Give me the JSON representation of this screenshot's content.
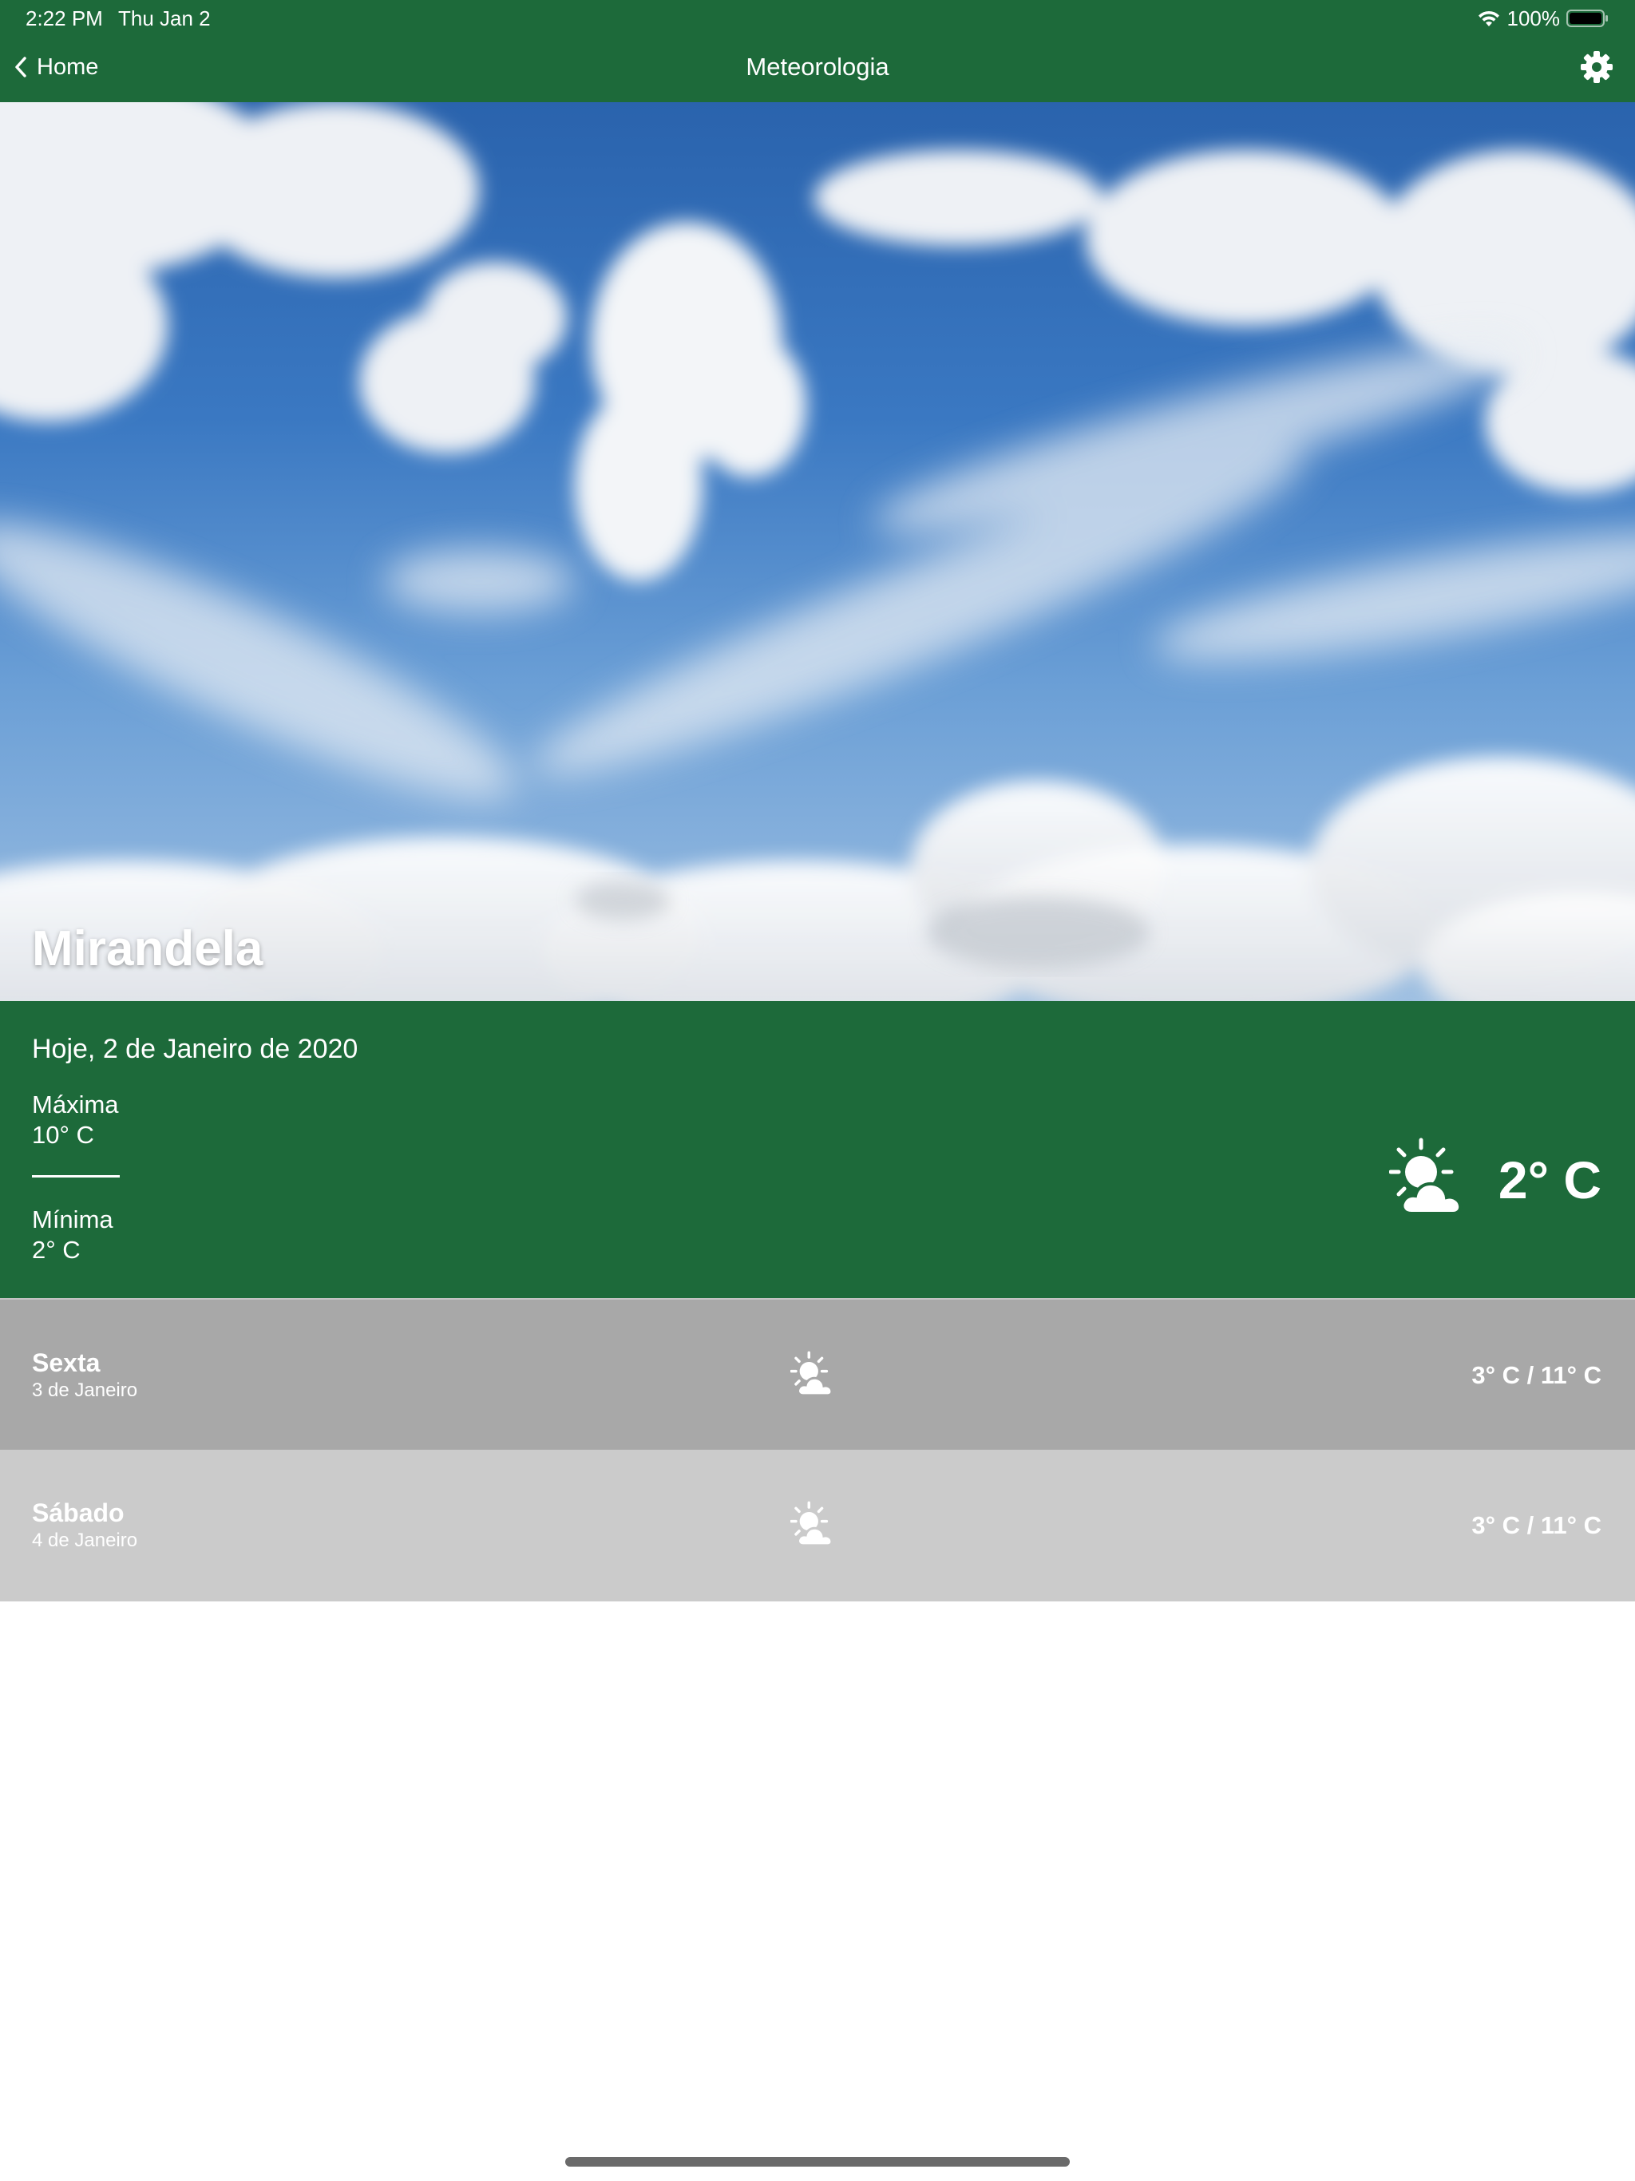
{
  "status_bar": {
    "time": "2:22 PM",
    "date": "Thu Jan 2",
    "battery": "100%",
    "wifi_icon": "wifi-icon",
    "battery_icon": "battery-icon"
  },
  "nav": {
    "back_label": "Home",
    "title": "Meteorologia",
    "settings_icon": "gear-icon"
  },
  "hero": {
    "city": "Mirandela"
  },
  "today": {
    "date_label": "Hoje, 2 de Janeiro de 2020",
    "max_label": "Máxima",
    "max_value": "10° C",
    "min_label": "Mínima",
    "min_value": "2° C",
    "current_temp": "2° C",
    "icon": "partly-cloudy-icon"
  },
  "forecast": [
    {
      "day": "Sexta",
      "date": "3 de Janeiro",
      "icon": "partly-cloudy-icon",
      "temps": "3° C / 11° C"
    },
    {
      "day": "Sábado",
      "date": "4 de Janeiro",
      "icon": "partly-cloudy-icon",
      "temps": "3° C / 11° C"
    }
  ],
  "colors": {
    "primary_green": "#1d6a3a",
    "row_dark_gray": "#a8a8a8",
    "row_light_gray": "#cbcbcb"
  }
}
